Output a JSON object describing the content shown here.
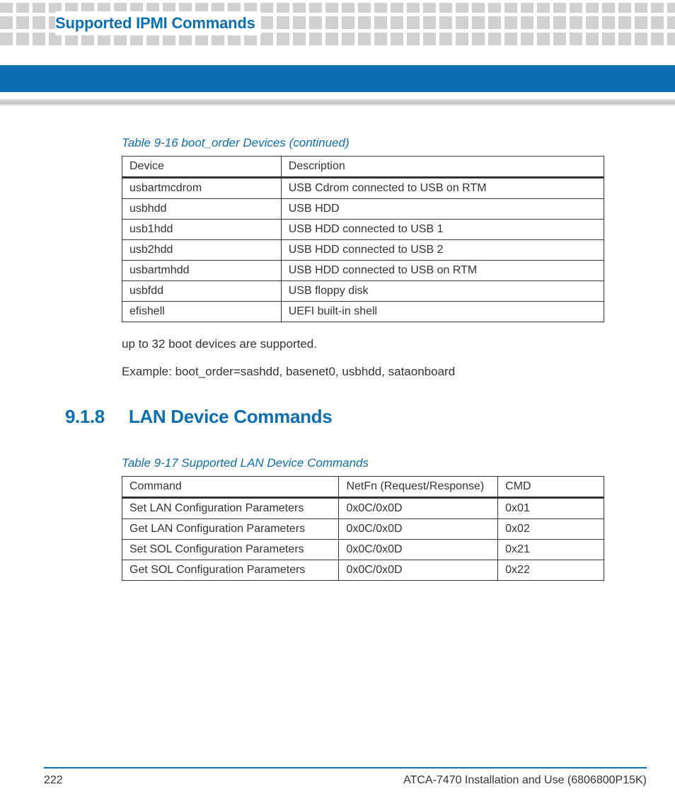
{
  "header": {
    "title": "Supported IPMI Commands"
  },
  "tables": {
    "t1": {
      "caption": "Table 9-16 boot_order Devices (continued)",
      "head": [
        "Device",
        "Description"
      ],
      "rows": [
        [
          "usbartmcdrom",
          "USB Cdrom connected to USB on RTM"
        ],
        [
          "usbhdd",
          "USB HDD"
        ],
        [
          "usb1hdd",
          "USB HDD connected to USB 1"
        ],
        [
          "usb2hdd",
          "USB HDD connected to USB 2"
        ],
        [
          "usbartmhdd",
          "USB HDD connected to USB on RTM"
        ],
        [
          "usbfdd",
          "USB floppy disk"
        ],
        [
          "efishell",
          "UEFI built-in shell"
        ]
      ]
    },
    "t2": {
      "caption": "Table 9-17 Supported LAN Device Commands",
      "head": [
        "Command",
        "NetFn (Request/Response)",
        "CMD"
      ],
      "rows": [
        [
          "Set LAN Configuration Parameters",
          "0x0C/0x0D",
          "0x01"
        ],
        [
          "Get LAN Configuration Parameters",
          "0x0C/0x0D",
          "0x02"
        ],
        [
          "Set SOL Configuration Parameters",
          "0x0C/0x0D",
          "0x21"
        ],
        [
          "Get SOL Configuration Parameters",
          "0x0C/0x0D",
          "0x22"
        ]
      ]
    }
  },
  "body": {
    "p1": "up to 32 boot devices are supported.",
    "p2": "Example: boot_order=sashdd, basenet0, usbhdd, sataonboard"
  },
  "section": {
    "num": "9.1.8",
    "title": "LAN Device Commands"
  },
  "footer": {
    "page": "222",
    "doc": "ATCA-7470 Installation and Use (6806800P15K)"
  }
}
